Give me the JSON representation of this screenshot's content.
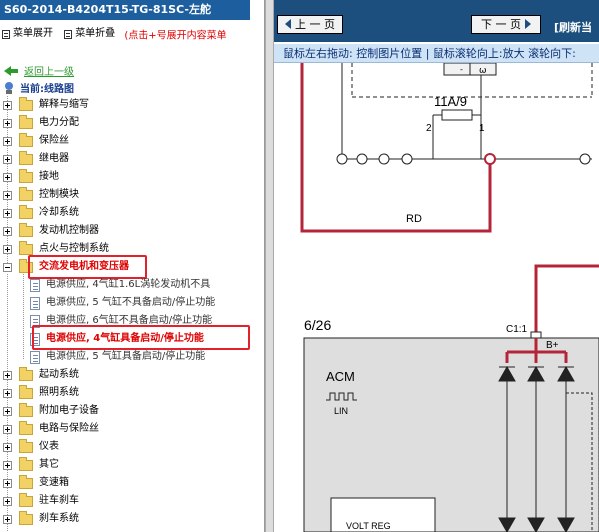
{
  "title": "S60-2014-B4204T15-TG-81SC-左舵",
  "toolbar": {
    "expand_label": "菜单展开",
    "collapse_label": "菜单折叠",
    "hint": "(点击+号展开内容菜单"
  },
  "nav": {
    "back_label": "返回上一级",
    "current_label": "当前:线路图"
  },
  "tree": {
    "items": [
      "解释与缩写",
      "电力分配",
      "保险丝",
      "继电器",
      "接地",
      "控制模块",
      "冷却系统",
      "发动机控制器",
      "点火与控制系统",
      "交流发电机和变压器",
      "起动系统",
      "照明系统",
      "附加电子设备",
      "电路与保险丝",
      "仪表",
      "其它",
      "变速箱",
      "驻车刹车",
      "刹车系统"
    ],
    "subitems": [
      "电源供应, 4气缸1.6L涡轮发动机不具",
      "电源供应, 5 气缸不具备启动/停止功能",
      "电源供应, 6气缸不具备启动/停止功能",
      "电源供应, 4气缸具备启动/停止功能",
      "电源供应, 5 气缸具备启动/停止功能"
    ]
  },
  "viewer": {
    "prev_label": "上 一 页",
    "next_label": "下 一 页",
    "refresh_label": "[刷新当",
    "info_text": "鼠标左右拖动: 控制图片位置 | 鼠标滚轮向上:放大 滚轮向下:"
  },
  "diagram": {
    "fuse_label": "11A/9",
    "pin_left": "2",
    "pin_right": "1",
    "wire_label": "RD",
    "page_ref": "6/26",
    "connector": "C1:1",
    "bplus": "B+",
    "module": "ACM",
    "lin": "LIN",
    "regulator": "VOLT REG",
    "wire_color": "#b5253a",
    "accent": "#e2212a"
  }
}
